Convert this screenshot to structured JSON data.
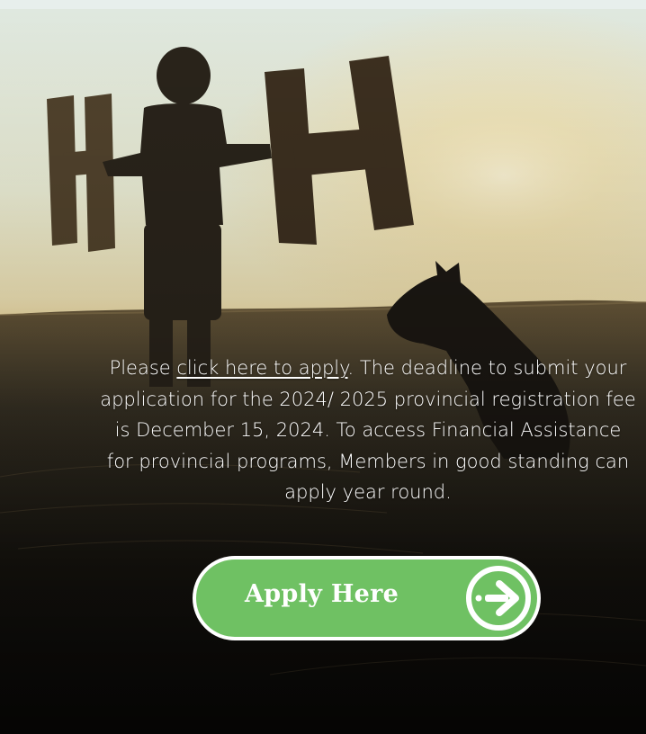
{
  "hero": {
    "image_alt": "Child holding large letter H cut-outs with a dog in a field at sunset"
  },
  "intro": {
    "text_before_link": "Please ",
    "link_label": "click here to apply",
    "text_after_link": ". The deadline to submit your application for the 2024/ 2025 provincial registration fee is December 15, 2024. To access Financial Assistance for provincial programs, Members in good standing can apply year round."
  },
  "apply_button": {
    "label": "Apply Here",
    "icon": "arrow-right-circle-icon"
  },
  "colors": {
    "top_strip": "#e7efec",
    "button_green": "#6fc163",
    "button_border": "#ffffff",
    "text": "#ffffff"
  }
}
